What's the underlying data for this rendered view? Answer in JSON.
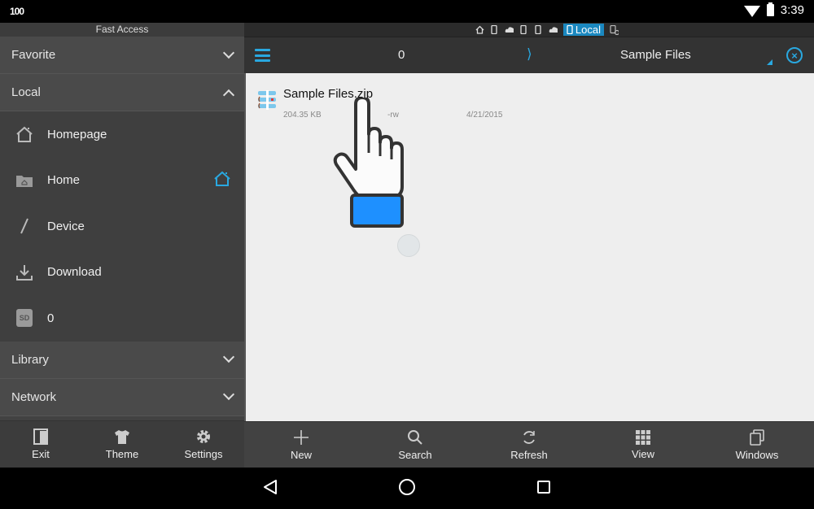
{
  "status_bar": {
    "left_indicator": "100",
    "time": "3:39",
    "icons": [
      "wifi-icon",
      "battery-icon"
    ]
  },
  "sidebar": {
    "header": "Fast Access",
    "sections": [
      {
        "label": "Favorite",
        "expanded": false
      },
      {
        "label": "Local",
        "expanded": true
      },
      {
        "label": "Library",
        "expanded": false
      },
      {
        "label": "Network",
        "expanded": false
      }
    ],
    "local_items": [
      {
        "label": "Homepage",
        "icon": "homepage-icon"
      },
      {
        "label": "Home",
        "icon": "home-folder-icon",
        "trailing_icon": "home-icon"
      },
      {
        "label": "Device",
        "icon": "device-slash-icon"
      },
      {
        "label": "Download",
        "icon": "download-icon"
      },
      {
        "label": "0",
        "icon": "sd-card-icon",
        "icon_text": "SD"
      }
    ],
    "bottom_buttons": [
      {
        "label": "Exit",
        "icon": "exit-icon"
      },
      {
        "label": "Theme",
        "icon": "theme-shirt-icon"
      },
      {
        "label": "Settings",
        "icon": "gear-icon"
      }
    ]
  },
  "window_tabs": {
    "icons": [
      "home-icon",
      "phone-icon",
      "cloud-icon",
      "phone-icon",
      "phone-icon",
      "cloud-icon"
    ],
    "active_label": "Local",
    "trailing_icon": "device-manage-icon"
  },
  "path_bar": {
    "crumbs": [
      "0",
      "Sample Files"
    ],
    "separator": "⟩",
    "close_symbol": "×"
  },
  "files": [
    {
      "name": "Sample Files.zip",
      "size": "204.35 KB",
      "permissions": "-rw",
      "date": "4/21/2015",
      "icon": "zip-archive-icon"
    }
  ],
  "bottom_toolbar": [
    {
      "label": "New",
      "icon": "plus-icon"
    },
    {
      "label": "Search",
      "icon": "search-icon"
    },
    {
      "label": "Refresh",
      "icon": "refresh-icon"
    },
    {
      "label": "View",
      "icon": "grid-view-icon"
    },
    {
      "label": "Windows",
      "icon": "windows-icon"
    }
  ],
  "colors": {
    "accent": "#29a8e0",
    "active_tab": "#1a88c0",
    "sidebar_bg": "#424242",
    "content_bg": "#eeeeee",
    "hand_cuff": "#1e90ff"
  }
}
